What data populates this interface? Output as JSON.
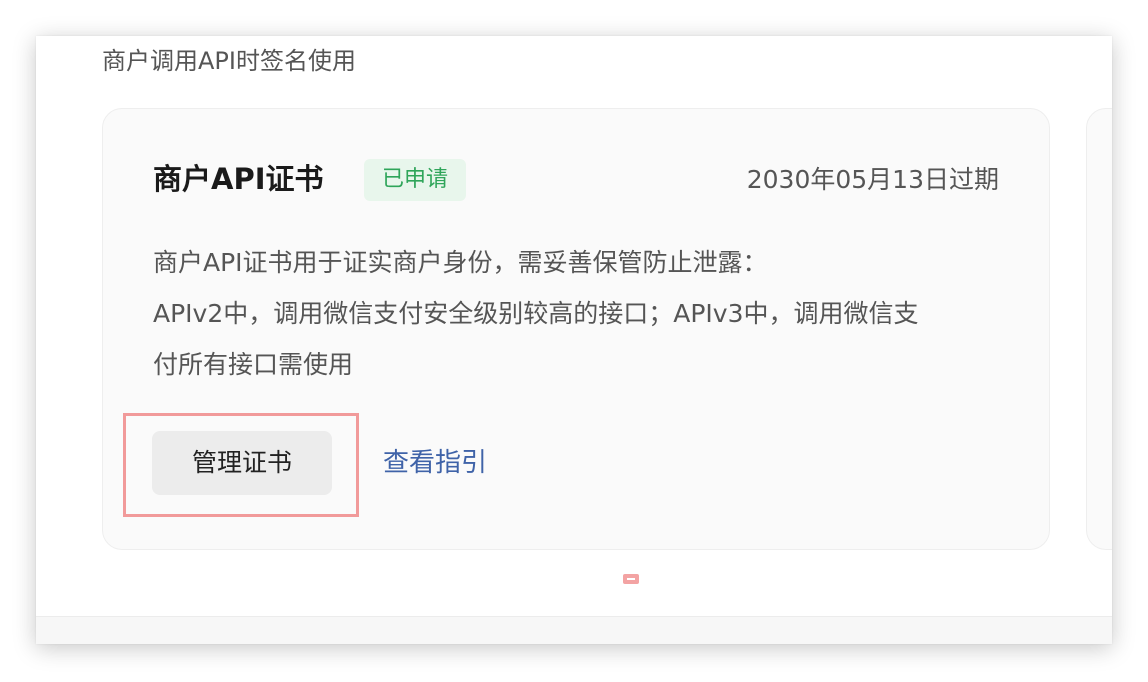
{
  "section": {
    "description": "商户调用API时签名使用"
  },
  "certificate_card": {
    "title": "商户API证书",
    "status_badge": "已申请",
    "expire_date": "2030年05月13日过期",
    "description_lines": [
      "商户API证书用于证实商户身份，需妥善保管防止泄露：",
      "APIv2中，调用微信支付安全级别较高的接口；APIv3中，调用微信支",
      "付所有接口需使用"
    ],
    "manage_button_label": "管理证书",
    "guide_link_label": "查看指引"
  },
  "colors": {
    "status_green": "#2fa55a",
    "status_bg": "#e8f6ec",
    "link_blue": "#3f63a8",
    "highlight_red": "#f19a9a"
  }
}
